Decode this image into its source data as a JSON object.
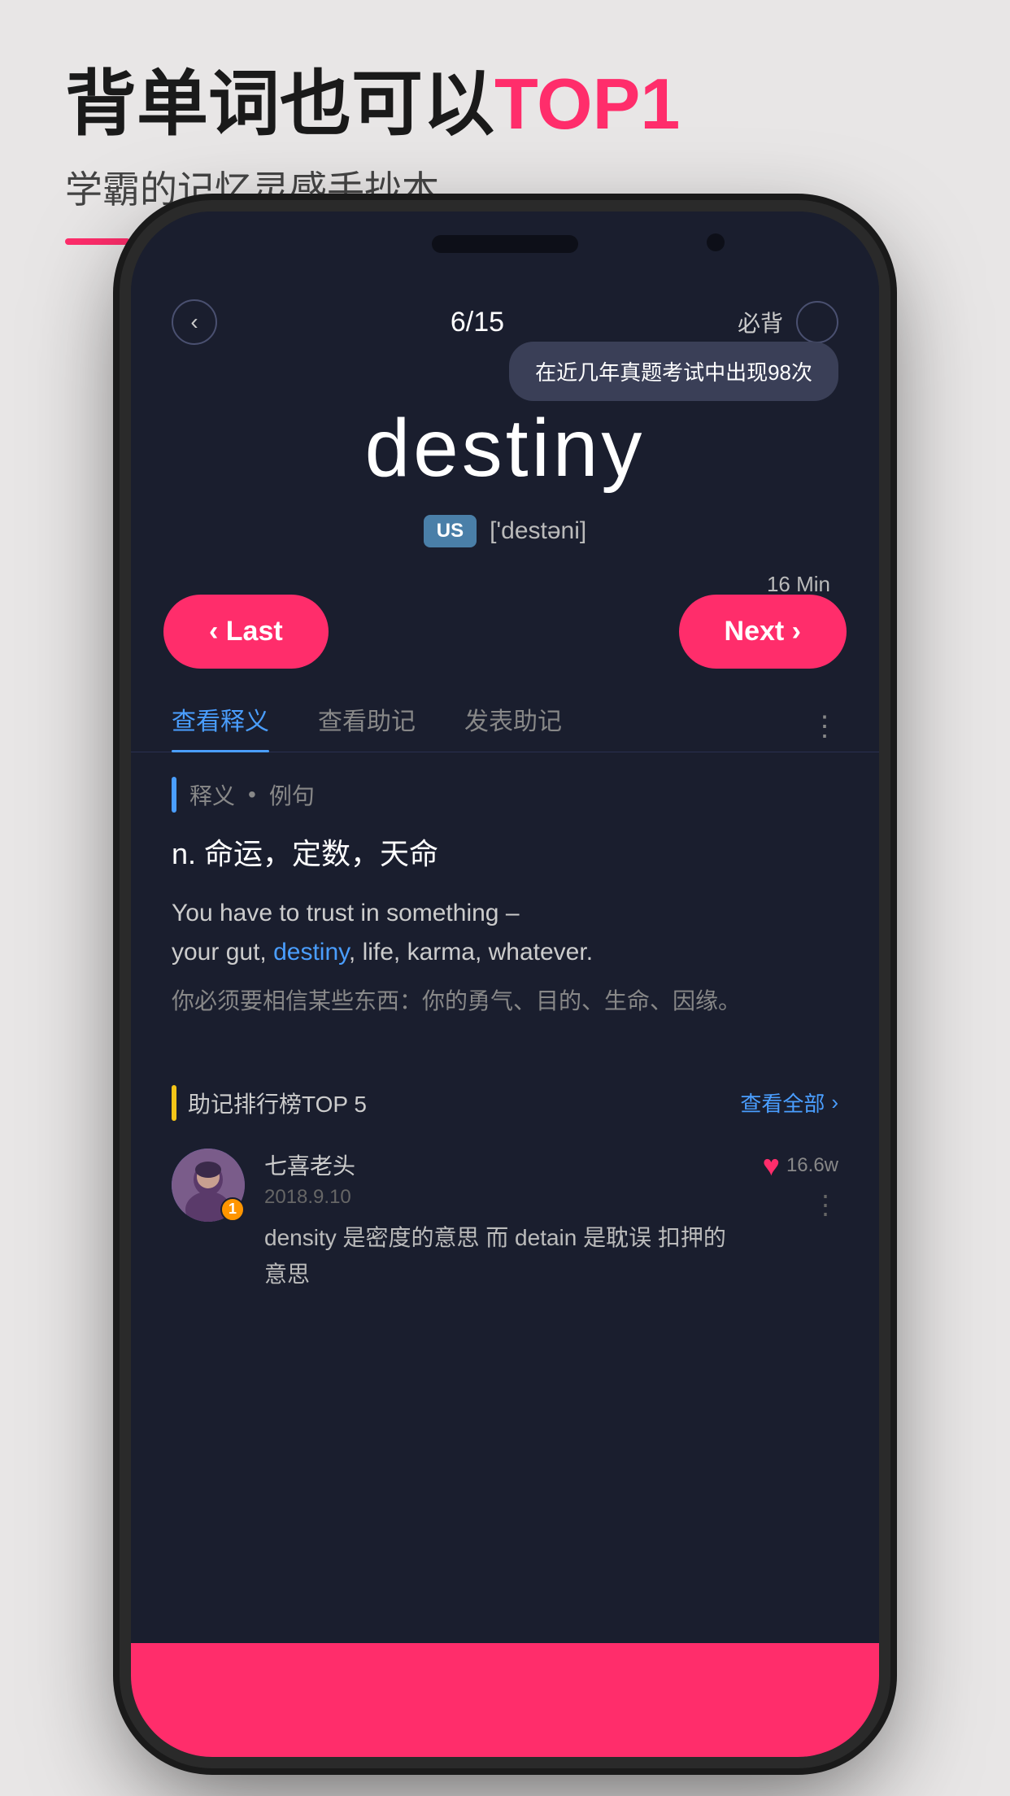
{
  "page": {
    "background_color": "#e8e6e6"
  },
  "top_section": {
    "title_part1": "背单词也可以",
    "title_highlight": "TOP1",
    "subtitle": "学霸的记忆灵感手抄本"
  },
  "phone": {
    "speaker_visible": true,
    "nav": {
      "back_icon": "‹",
      "progress": "6/15",
      "must_label": "必背",
      "circle_empty": true
    },
    "tooltip": "在近几年真题考试中出现98次",
    "word": {
      "text": "destiny",
      "pronunciation_badge": "US",
      "pronunciation_text": "['destəni]"
    },
    "time_label": "16 Min",
    "buttons": {
      "last_label": "‹ Last",
      "next_label": "Next ›"
    },
    "tabs": [
      {
        "label": "查看释义",
        "active": true
      },
      {
        "label": "查看助记",
        "active": false
      },
      {
        "label": "发表助记",
        "active": false
      }
    ],
    "tabs_more_icon": "⋮",
    "definition": {
      "section_label": "释义",
      "section_sub": "例句",
      "pos": "n.",
      "meanings": "命运，定数，天命",
      "example_en": "You have to trust in something – your gut, destiny, life, karma, whatever.",
      "example_cn": "你必须要相信某些东西：你的勇气、目的、生命、因缘。",
      "highlight_word": "destiny"
    },
    "mnemonic": {
      "section_label": "助记排行榜TOP 5",
      "view_all": "查看全部",
      "user": {
        "name": "七喜老头",
        "date": "2018.9.10",
        "badge": "1",
        "content": "density 是密度的意思  而 detain 是耽误 扣押的意思",
        "likes": "16.6w"
      }
    }
  }
}
